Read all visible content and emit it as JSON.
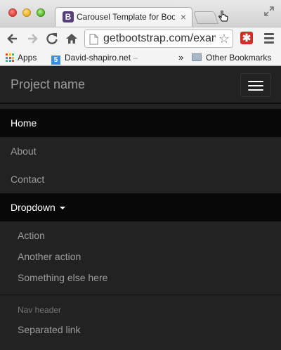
{
  "browser": {
    "tab_favicon": "B",
    "tab_title": "Carousel Template for Bootstrap",
    "tab_close": "×",
    "url": "getbootstrap.com/examples/carousel/",
    "ext_icon": "✱",
    "icons": [
      "back-icon",
      "forward-icon",
      "reload-icon",
      "home-icon",
      "star-icon",
      "menu-icon",
      "fullscreen-icon"
    ]
  },
  "bookmarks": {
    "apps": "Apps",
    "david_fav": "5",
    "david_label": "David-shapiro.net",
    "david_suffix": " –",
    "overflow": "»",
    "other": "Other Bookmarks"
  },
  "navbar": {
    "brand": "Project name",
    "items": [
      {
        "label": "Home"
      },
      {
        "label": "About"
      },
      {
        "label": "Contact"
      }
    ],
    "dropdown": {
      "label": "Dropdown",
      "items": [
        "Action",
        "Another action",
        "Something else here"
      ],
      "header": "Nav header",
      "separated": "Separated link"
    }
  },
  "colors": {
    "navbar_bg": "#222222",
    "active_bg": "#080808",
    "link": "#9d9d9d",
    "active_link": "#ffffff",
    "bootstrap_purple": "#563d7c"
  }
}
